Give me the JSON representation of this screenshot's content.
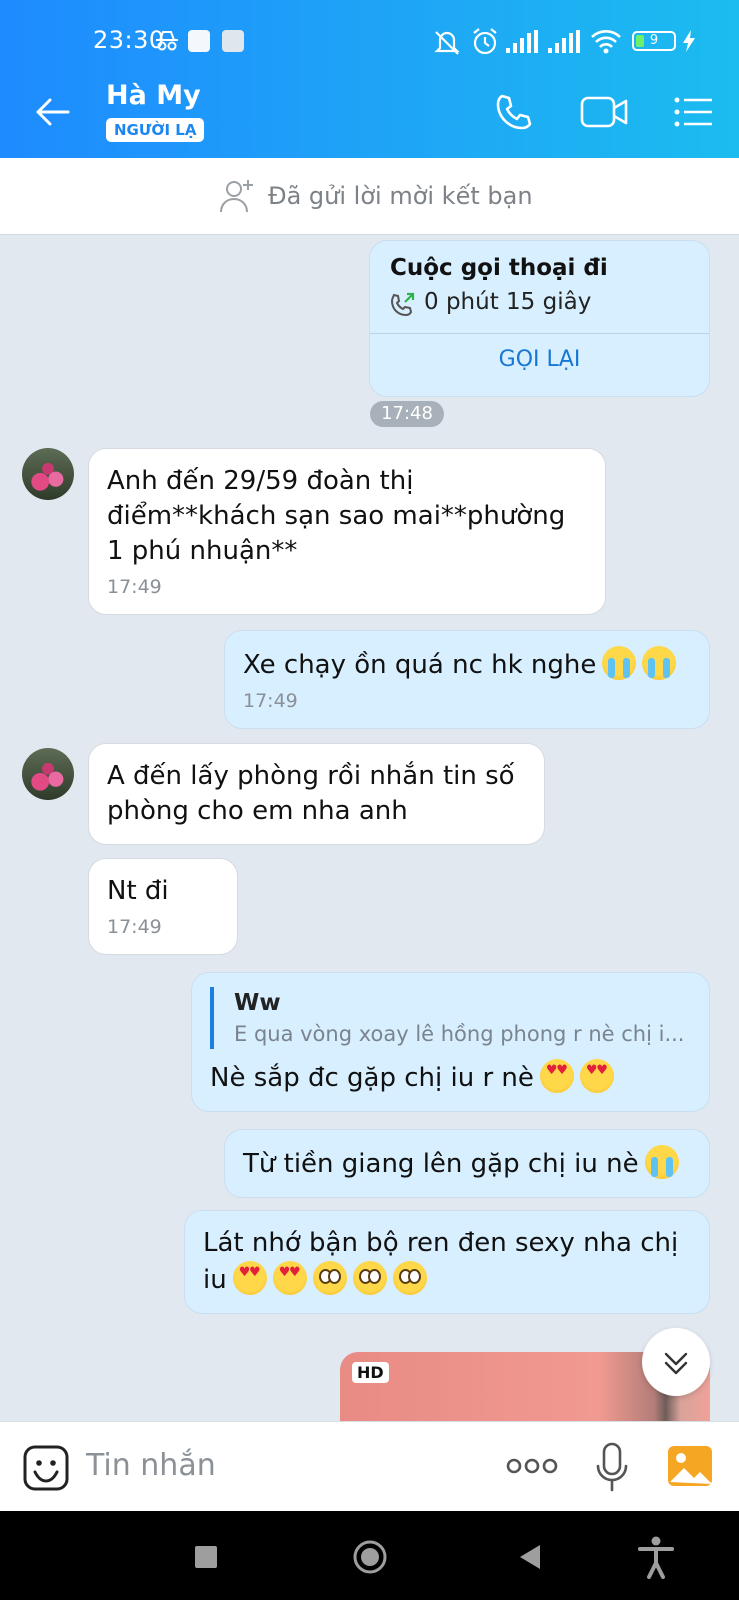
{
  "status_bar": {
    "time": "23:30",
    "battery": "9"
  },
  "header": {
    "contact_name": "Hà My",
    "badge": "NGƯỜI LẠ"
  },
  "friend_request": {
    "text": "Đã gửi lời mời kết bạn"
  },
  "call_card": {
    "title": "Cuộc gọi thoại đi",
    "duration": "0 phút 15 giây",
    "action": "GỌI LẠI"
  },
  "time_divider": "17:48",
  "messages": [
    {
      "direction": "in",
      "text": "Anh đến 29/59 đoàn thị điểm**khách sạn sao mai**phường 1 phú nhuận**",
      "time": "17:49"
    },
    {
      "direction": "out",
      "text": "Xe chạy ồn quá nc hk nghe",
      "emojis": [
        "cry",
        "cry"
      ],
      "time": "17:49"
    },
    {
      "direction": "in",
      "text": "A đến lấy phòng rồi nhắn tin số phòng cho em nha anh"
    },
    {
      "direction": "in",
      "text": "Nt đi",
      "time": "17:49"
    },
    {
      "direction": "out",
      "quote_name": "Ww",
      "quote_text": "E qua vòng xoay lê hồng phong r nè chị i...",
      "text": "Nè sắp đc gặp chị iu r nè",
      "emojis": [
        "heart",
        "heart"
      ]
    },
    {
      "direction": "out",
      "text": "Từ tiền giang lên gặp chị iu nè",
      "emojis": [
        "cry"
      ]
    },
    {
      "direction": "out",
      "text": "Lát nhớ bận bộ ren đen sexy nha chị iu",
      "emojis": [
        "heart",
        "heart",
        "flush",
        "flush",
        "flush"
      ]
    }
  ],
  "image_message": {
    "badge": "HD"
  },
  "composer": {
    "placeholder": "Tin nhắn"
  },
  "colors": {
    "header_gradient_start": "#1e8bff",
    "header_gradient_end": "#1bbcf0",
    "out_bubble": "#d8efff",
    "in_bubble": "#ffffff",
    "chat_background": "#e2e8f0",
    "link_blue": "#1677d6"
  }
}
